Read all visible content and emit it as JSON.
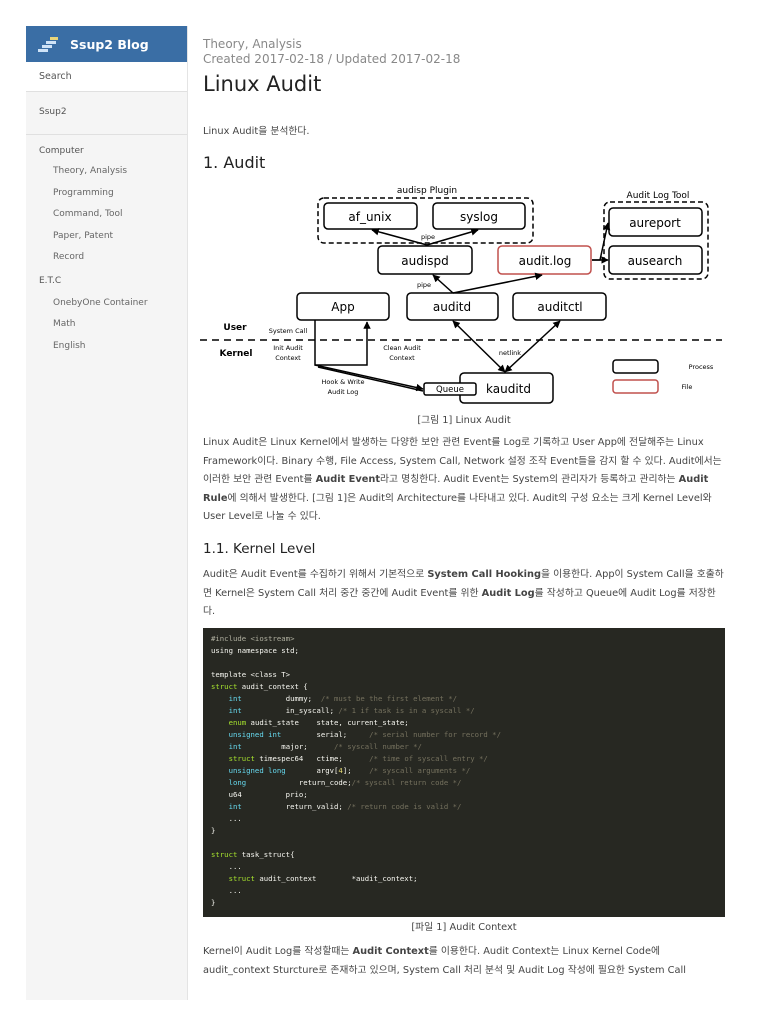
{
  "sidebar": {
    "brand": "Ssup2 Blog",
    "search": "Search",
    "home": "Ssup2",
    "groups": [
      {
        "label": "Computer",
        "items": [
          "Theory, Analysis",
          "Programming",
          "Command, Tool",
          "Paper, Patent",
          "Record"
        ]
      },
      {
        "label": "E.T.C",
        "items": [
          "OnebyOne Container",
          "Math",
          "English"
        ]
      }
    ]
  },
  "post": {
    "category": "Theory, Analysis",
    "dates": "Created 2017-02-18 / Updated 2017-02-18",
    "title": "Linux Audit",
    "intro": "Linux Audit을 분석한다.",
    "h_audit": "1. Audit",
    "figure_caption": "[그림 1] Linux Audit",
    "para1": [
      {
        "t": "Linux Audit은 Linux Kernel에서 발생하는 다양한 보안 관련 Event를 Log로 기록하고 User App에 전달해주는 Linux Framework이다. Binary 수행, File Access, System Call, Network 설정 조작 Event들을 감지 할 수 있다. Audit에서는 이러한 보안 관련 Event를 "
      },
      {
        "t": "Audit Event",
        "b": true
      },
      {
        "t": "라고 명칭한다. Audit Event는 System의 관리자가 등록하고 관리하는 "
      },
      {
        "t": "Audit Rule",
        "b": true
      },
      {
        "t": "에 의해서 발생한다. [그림 1]은 Audit의 Architecture를 나타내고 있다. Audit의 구성 요소는 크게 Kernel Level와 User Level로 나눌 수 있다."
      }
    ],
    "h_kernel": "1.1. Kernel Level",
    "para2": [
      {
        "t": "Audit은 Audit Event를 수집하기 위해서 기본적으로 "
      },
      {
        "t": "System Call Hooking",
        "b": true
      },
      {
        "t": "을 이용한다. App이 System Call을 호출하면 Kernel은 System Call 처리 중간 중간에 Audit Event를 위한 "
      },
      {
        "t": "Audit Log",
        "b": true
      },
      {
        "t": "를 작성하고 Queue에 Audit Log를 저장한다."
      }
    ],
    "code_caption": "[파일 1] Audit Context",
    "para3": [
      {
        "t": "Kernel이 Audit Log를 작성할때는 "
      },
      {
        "t": "Audit Context",
        "b": true
      },
      {
        "t": "를 이용한다. Audit Context는 Linux Kernel Code에 audit_context Sturcture로 존재하고 있으며, System Call 처리 분석 및 Audit Log 작성에 필요한 System Call"
      }
    ]
  },
  "diagram": {
    "plugin_group": "audisp Plugin",
    "tool_group": "Audit Log Tool",
    "af_unix": "af_unix",
    "syslog": "syslog",
    "audispd": "audispd",
    "audit_log": "audit.log",
    "aureport": "aureport",
    "ausearch": "ausearch",
    "app": "App",
    "auditd": "auditd",
    "auditctl": "auditctl",
    "kauditd": "kauditd",
    "queue": "Queue",
    "user": "User",
    "kernel": "Kernel",
    "pipe1": "pipe",
    "pipe2": "pipe",
    "system_call": "System Call",
    "init1": "Init Audit",
    "init2": "Context",
    "clean1": "Clean Audit",
    "clean2": "Context",
    "netlink": "netlink",
    "hook1": "Hook & Write",
    "hook2": "Audit Log",
    "legend_process": "Process",
    "legend_file": "File",
    "file_color": "#c0504d"
  },
  "code": [
    [
      [
        "pp",
        "#include <iostream>"
      ]
    ],
    [
      [
        "",
        "using namespace std;"
      ]
    ],
    [],
    [
      [
        "",
        "template <class T>"
      ]
    ],
    [
      [
        "st",
        "struct"
      ],
      [
        "",
        " audit_context {"
      ]
    ],
    [
      [
        "",
        "    "
      ],
      [
        "kw",
        "int"
      ],
      [
        "",
        "          dummy;  "
      ],
      [
        "cm",
        "/* must be the first element */"
      ]
    ],
    [
      [
        "",
        "    "
      ],
      [
        "kw",
        "int"
      ],
      [
        "",
        "          in_syscall; "
      ],
      [
        "cm",
        "/* 1 if task is in a syscall */"
      ]
    ],
    [
      [
        "",
        "    "
      ],
      [
        "st",
        "enum"
      ],
      [
        "",
        " audit_state    state, current_state;"
      ]
    ],
    [
      [
        "",
        "    "
      ],
      [
        "kw",
        "unsigned int"
      ],
      [
        "",
        "        serial;     "
      ],
      [
        "cm",
        "/* serial number for record */"
      ]
    ],
    [
      [
        "",
        "    "
      ],
      [
        "kw",
        "int"
      ],
      [
        "",
        "         major;      "
      ],
      [
        "cm",
        "/* syscall number */"
      ]
    ],
    [
      [
        "",
        "    "
      ],
      [
        "st",
        "struct"
      ],
      [
        "",
        " timespec64   ctime;      "
      ],
      [
        "cm",
        "/* time of syscall entry */"
      ]
    ],
    [
      [
        "",
        "    "
      ],
      [
        "kw",
        "unsigned long"
      ],
      [
        "",
        "       argv["
      ],
      [
        "num",
        "4"
      ],
      [
        "",
        "];    "
      ],
      [
        "cm",
        "/* syscall arguments */"
      ]
    ],
    [
      [
        "",
        "    "
      ],
      [
        "kw",
        "long"
      ],
      [
        "",
        "            return_code;"
      ],
      [
        "cm",
        "/* syscall return code */"
      ]
    ],
    [
      [
        "",
        "    u64          prio;"
      ]
    ],
    [
      [
        "",
        "    "
      ],
      [
        "kw",
        "int"
      ],
      [
        "",
        "          return_valid; "
      ],
      [
        "cm",
        "/* return code is valid */"
      ]
    ],
    [
      [
        "",
        "    ..."
      ]
    ],
    [
      [
        "",
        "}"
      ]
    ],
    [],
    [
      [
        "st",
        "struct"
      ],
      [
        "",
        " task_struct{"
      ]
    ],
    [
      [
        "",
        "    ..."
      ]
    ],
    [
      [
        "",
        "    "
      ],
      [
        "st",
        "struct"
      ],
      [
        "",
        " audit_context        *audit_context;"
      ]
    ],
    [
      [
        "",
        "    ..."
      ]
    ],
    [
      [
        "",
        "}"
      ]
    ]
  ]
}
